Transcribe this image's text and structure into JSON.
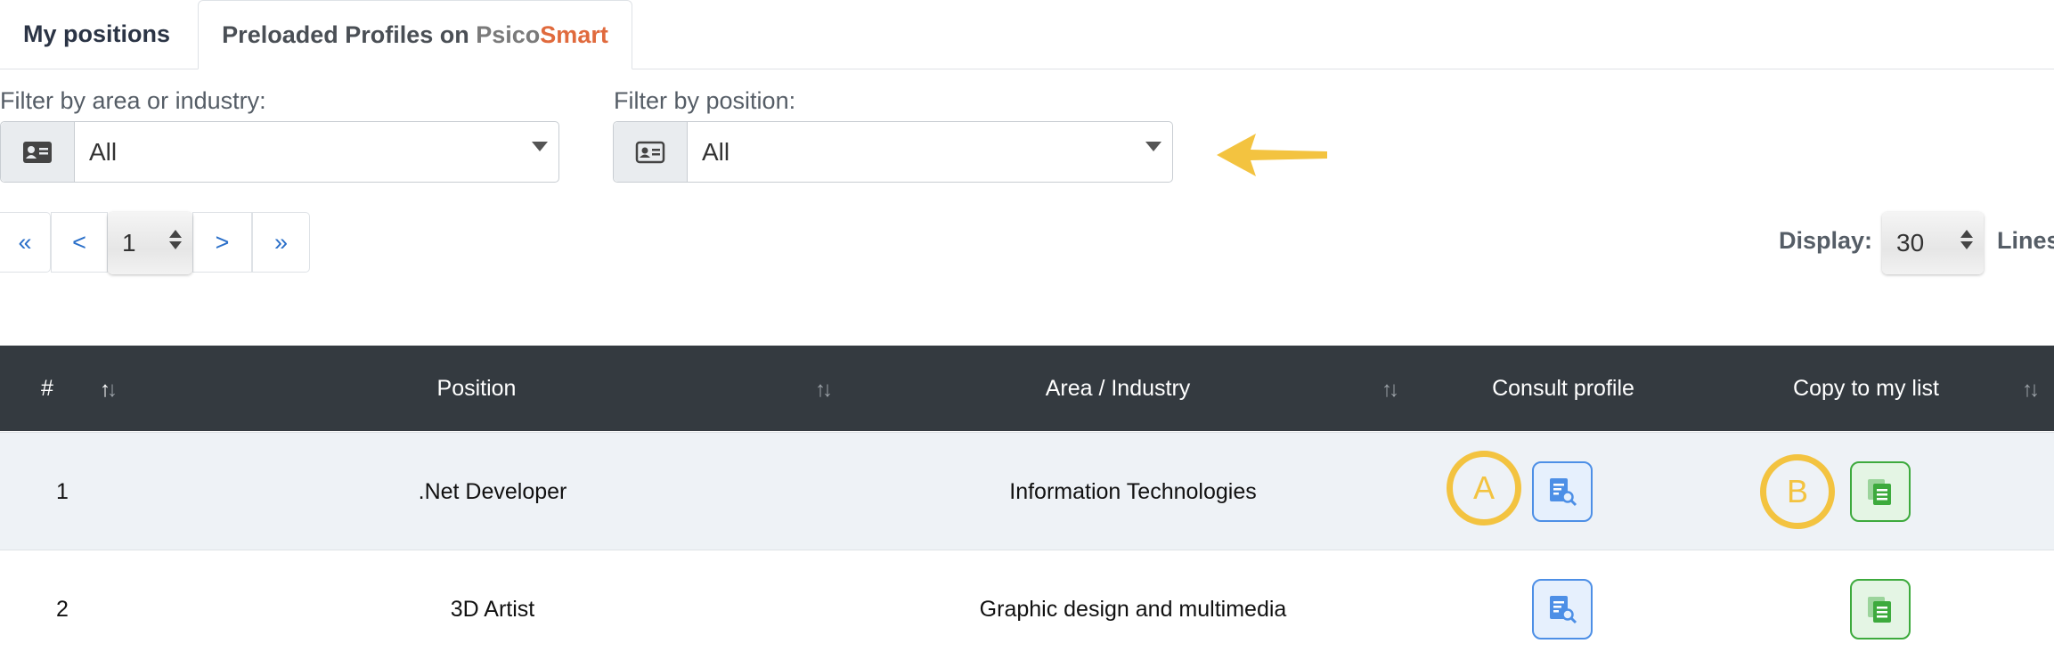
{
  "tabs": [
    {
      "label": "My positions"
    },
    {
      "label_prefix": "Preloaded Profiles on ",
      "brand_a": "Psico",
      "brand_b": "Smart"
    }
  ],
  "filters": {
    "area": {
      "label": "Filter by area or industry:",
      "value": "All",
      "icon": "id-card-icon"
    },
    "position": {
      "label": "Filter by position:",
      "value": "All",
      "icon": "id-card-icon"
    }
  },
  "pagination": {
    "first": "«",
    "prev": "<",
    "page": "1",
    "next": ">",
    "last": "»"
  },
  "display": {
    "label": "Display:",
    "value": "30",
    "suffix": "Lines"
  },
  "table": {
    "headers": {
      "num": "#",
      "position": "Position",
      "area": "Area / Industry",
      "consult": "Consult profile",
      "copy": "Copy to my list"
    },
    "rows": [
      {
        "num": "1",
        "position": ".Net Developer",
        "area": "Information Technologies"
      },
      {
        "num": "2",
        "position": "3D Artist",
        "area": "Graphic design and multimedia"
      }
    ]
  },
  "annotations": {
    "a": "A",
    "b": "B"
  },
  "colors": {
    "header_bg": "#343a40",
    "marker": "#f3c340",
    "brand_smart": "#e06a3d",
    "link": "#2a6fc9"
  }
}
